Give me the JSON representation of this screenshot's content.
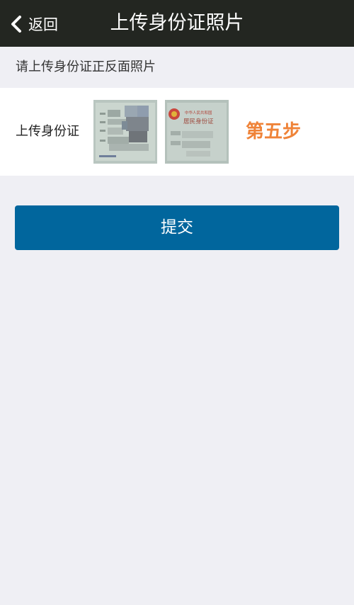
{
  "nav": {
    "back_label": "返回",
    "title": "上传身份证照片"
  },
  "instruction": "请上传身份证正反面照片",
  "upload": {
    "label": "上传身份证",
    "front_card_icon": "id-card-front-thumbnail",
    "back_card_icon": "id-card-back-thumbnail",
    "back_card_heading_1": "中华人民共和国",
    "back_card_heading_2": "居民身份证",
    "step_label": "第五步"
  },
  "submit_label": "提交",
  "colors": {
    "nav_background": "#232621",
    "page_background": "#efeff4",
    "step_accent": "#ef8338",
    "submit_background": "#01669d"
  }
}
